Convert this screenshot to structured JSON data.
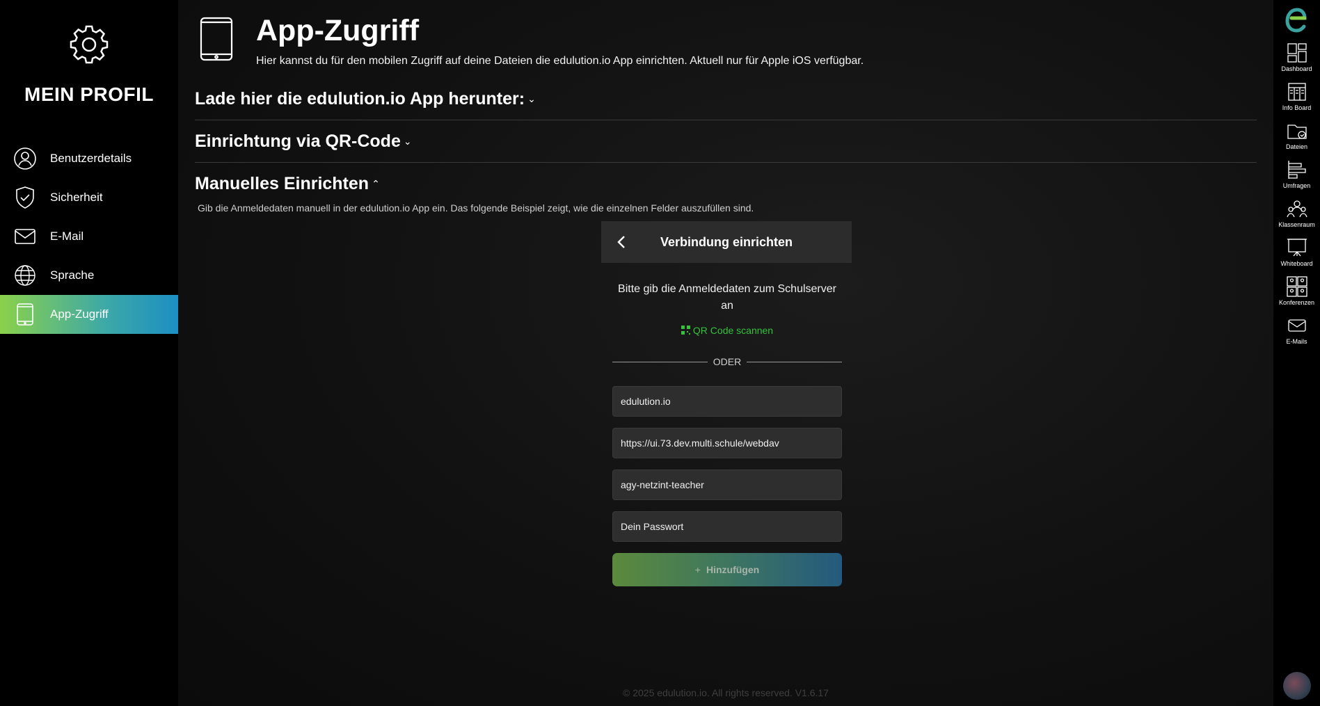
{
  "sidebar": {
    "title": "MEIN PROFIL",
    "items": [
      {
        "label": "Benutzerdetails",
        "icon": "user-gear-icon"
      },
      {
        "label": "Sicherheit",
        "icon": "shield-icon"
      },
      {
        "label": "E-Mail",
        "icon": "mail-icon"
      },
      {
        "label": "Sprache",
        "icon": "globe-icon"
      },
      {
        "label": "App-Zugriff",
        "icon": "tablet-icon",
        "active": true
      }
    ]
  },
  "header": {
    "title": "App-Zugriff",
    "subtitle": "Hier kannst du für den mobilen Zugriff auf deine Dateien die edulution.io App einrichten. Aktuell nur für Apple iOS verfügbar."
  },
  "sections": [
    {
      "label": "Lade hier die edulution.io App herunter:",
      "expanded": false
    },
    {
      "label": "Einrichtung via QR-Code",
      "expanded": false
    },
    {
      "label": "Manuelles Einrichten",
      "expanded": true
    }
  ],
  "manual": {
    "description": "Gib die Anmeldedaten manuell in der edulution.io App ein. Das folgende Beispiel zeigt, wie die einzelnen Felder auszufüllen sind.",
    "card_title": "Verbindung einrichten",
    "prompt": "Bitte gib die Anmeldedaten zum Schulserver an",
    "qr_link": "QR Code scannen",
    "or_label": "ODER",
    "fields": [
      "edulution.io",
      "https://ui.73.dev.multi.schule/webdav",
      "agy-netzint-teacher",
      "Dein Passwort"
    ],
    "add_button": "Hinzufügen"
  },
  "footer": "© 2025 edulution.io. All rights reserved. V1.6.17",
  "rail": {
    "items": [
      {
        "label": "Dashboard",
        "icon": "dashboard-icon"
      },
      {
        "label": "Info Board",
        "icon": "info-board-icon"
      },
      {
        "label": "Dateien",
        "icon": "files-icon"
      },
      {
        "label": "Umfragen",
        "icon": "surveys-icon"
      },
      {
        "label": "Klassenraum",
        "icon": "classroom-icon"
      },
      {
        "label": "Whiteboard",
        "icon": "whiteboard-icon"
      },
      {
        "label": "Konferenzen",
        "icon": "conferences-icon"
      },
      {
        "label": "E-Mails",
        "icon": "mails-icon"
      }
    ]
  },
  "colors": {
    "accent_green": "#8bd14a",
    "accent_blue": "#1d8fc2",
    "link_green": "#35c23c"
  }
}
